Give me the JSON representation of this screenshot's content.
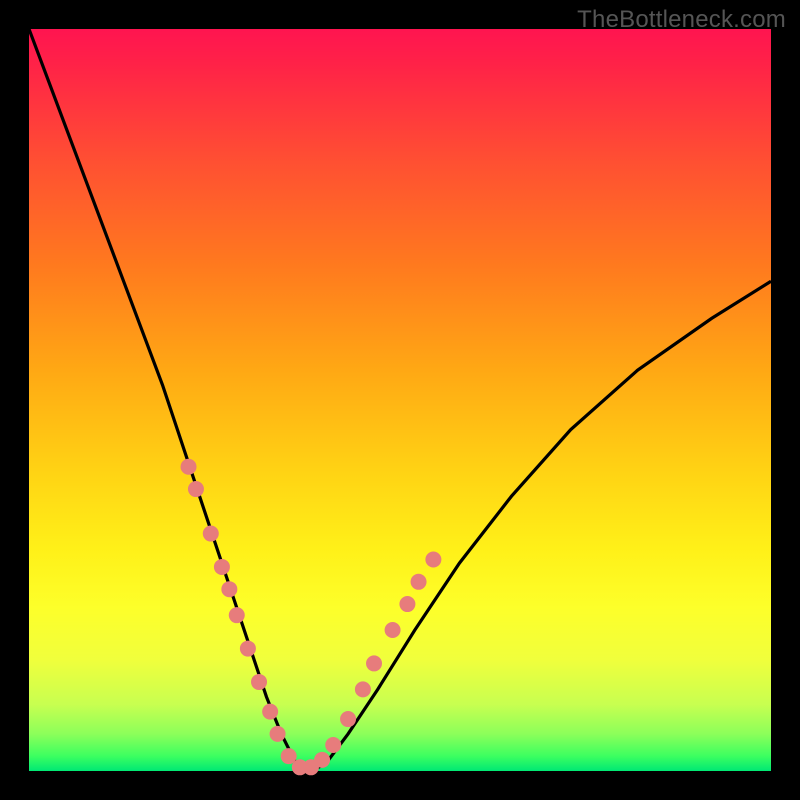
{
  "watermark": "TheBottleneck.com",
  "chart_data": {
    "type": "line",
    "title": "",
    "xlabel": "",
    "ylabel": "",
    "xlim": [
      0,
      100
    ],
    "ylim": [
      0,
      100
    ],
    "background_gradient": {
      "direction": "vertical",
      "stops": [
        {
          "pos": 0,
          "color": "#ff1450"
        },
        {
          "pos": 18,
          "color": "#ff5032"
        },
        {
          "pos": 46,
          "color": "#ffa814"
        },
        {
          "pos": 70,
          "color": "#fff018"
        },
        {
          "pos": 85,
          "color": "#f0ff3c"
        },
        {
          "pos": 95,
          "color": "#8cff5a"
        },
        {
          "pos": 100,
          "color": "#00e874"
        }
      ]
    },
    "series": [
      {
        "name": "bottleneck-curve",
        "x": [
          0,
          3,
          6,
          9,
          12,
          15,
          18,
          20,
          22,
          24,
          26,
          28,
          30,
          32,
          34,
          36,
          38,
          40,
          43,
          47,
          52,
          58,
          65,
          73,
          82,
          92,
          100
        ],
        "y": [
          100,
          92,
          84,
          76,
          68,
          60,
          52,
          46,
          40,
          34,
          28,
          22,
          16,
          10,
          5,
          1,
          0,
          1,
          5,
          11,
          19,
          28,
          37,
          46,
          54,
          61,
          66
        ]
      }
    ],
    "markers": {
      "name": "highlighted-points",
      "color": "#e77c7c",
      "radius": 8,
      "points": [
        {
          "x": 21.5,
          "y": 41
        },
        {
          "x": 22.5,
          "y": 38
        },
        {
          "x": 24.5,
          "y": 32
        },
        {
          "x": 26,
          "y": 27.5
        },
        {
          "x": 27,
          "y": 24.5
        },
        {
          "x": 28,
          "y": 21
        },
        {
          "x": 29.5,
          "y": 16.5
        },
        {
          "x": 31,
          "y": 12
        },
        {
          "x": 32.5,
          "y": 8
        },
        {
          "x": 33.5,
          "y": 5
        },
        {
          "x": 35,
          "y": 2
        },
        {
          "x": 36.5,
          "y": 0.5
        },
        {
          "x": 38,
          "y": 0.5
        },
        {
          "x": 39.5,
          "y": 1.5
        },
        {
          "x": 41,
          "y": 3.5
        },
        {
          "x": 43,
          "y": 7
        },
        {
          "x": 45,
          "y": 11
        },
        {
          "x": 46.5,
          "y": 14.5
        },
        {
          "x": 49,
          "y": 19
        },
        {
          "x": 51,
          "y": 22.5
        },
        {
          "x": 52.5,
          "y": 25.5
        },
        {
          "x": 54.5,
          "y": 28.5
        }
      ]
    }
  }
}
